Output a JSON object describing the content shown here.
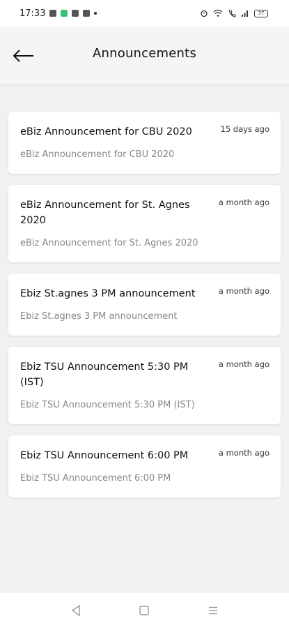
{
  "status_bar": {
    "time": "17:33",
    "battery": "37"
  },
  "header": {
    "title": "Announcements"
  },
  "announcements": [
    {
      "title": "eBiz Announcement for CBU 2020",
      "time": "15 days ago",
      "body": "eBiz Announcement for CBU 2020"
    },
    {
      "title": "eBiz Announcement for St. Agnes 2020",
      "time": "a month ago",
      "body": "eBiz Announcement for St. Agnes 2020"
    },
    {
      "title": "Ebiz St.agnes 3 PM announcement",
      "time": "a month ago",
      "body": "Ebiz St.agnes 3 PM announcement"
    },
    {
      "title": "Ebiz TSU Announcement 5:30 PM (IST)",
      "time": "a month ago",
      "body": "Ebiz TSU Announcement 5:30 PM (IST)"
    },
    {
      "title": "Ebiz TSU Announcement 6:00 PM",
      "time": "a month ago",
      "body": "Ebiz TSU Announcement 6:00 PM"
    }
  ],
  "icons": {
    "back": "arrow-left-icon",
    "nav_back": "triangle-back-icon",
    "nav_home": "square-home-icon",
    "nav_menu": "menu-lines-icon"
  }
}
